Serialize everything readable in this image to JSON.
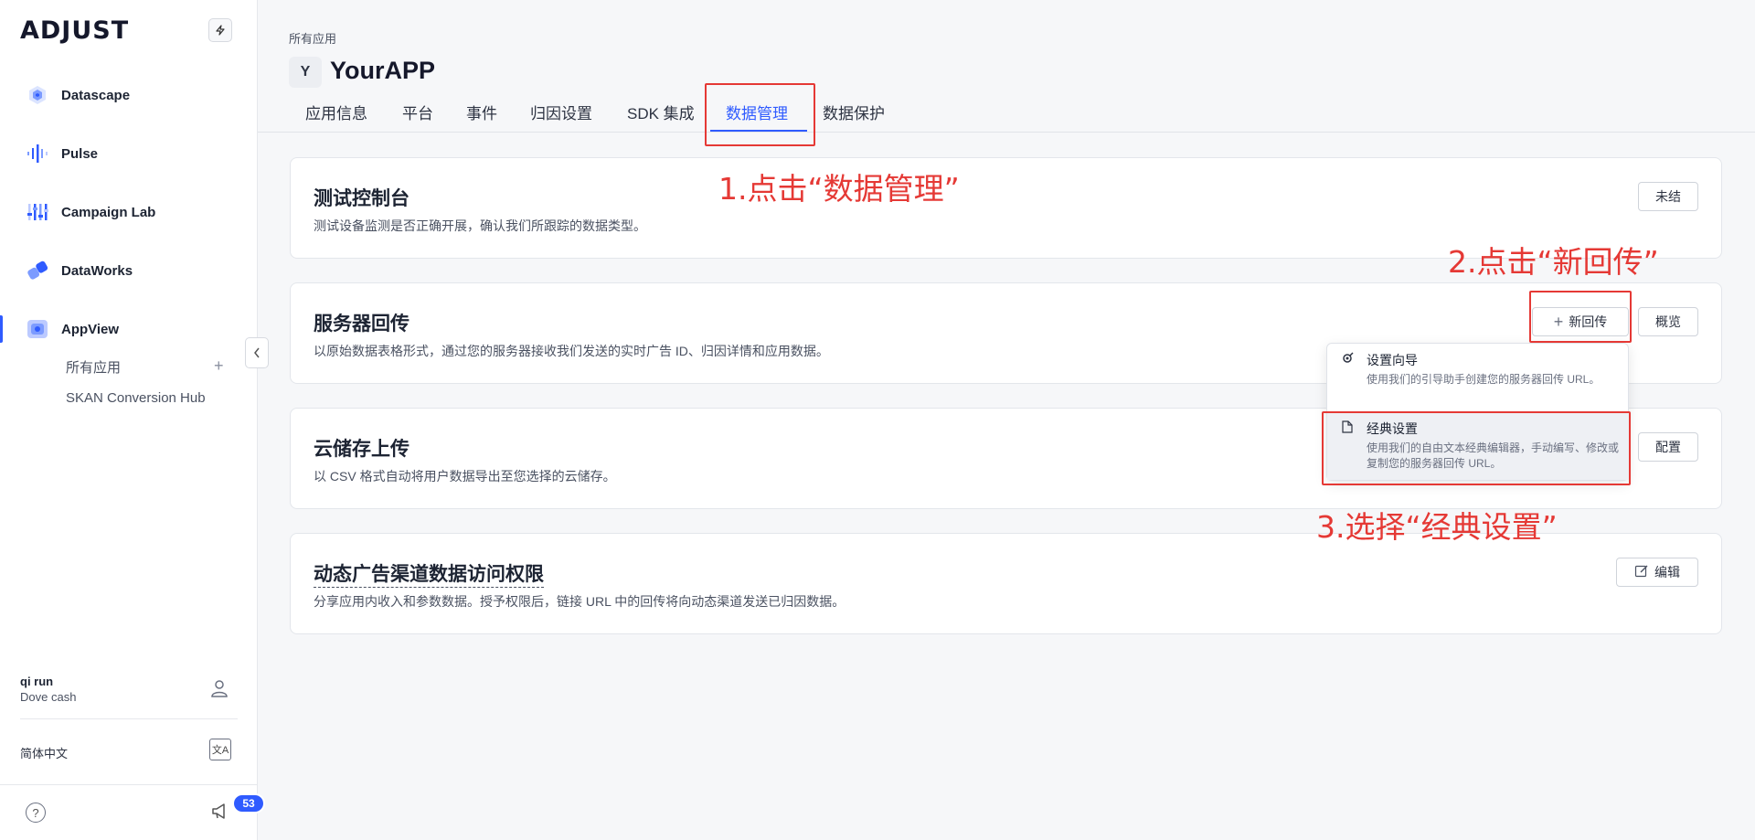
{
  "sidebar": {
    "logo": "ADJUST",
    "nav": [
      {
        "label": "Datascape",
        "icon": "datascape-icon"
      },
      {
        "label": "Pulse",
        "icon": "pulse-icon"
      },
      {
        "label": "Campaign Lab",
        "icon": "campaign-lab-icon"
      },
      {
        "label": "DataWorks",
        "icon": "dataworks-icon"
      },
      {
        "label": "AppView",
        "icon": "appview-icon"
      }
    ],
    "sub_items": [
      "所有应用",
      "SKAN Conversion Hub"
    ],
    "user": {
      "name": "qi run",
      "company": "Dove cash"
    },
    "language": "简体中文",
    "notification_count": "53"
  },
  "header": {
    "breadcrumb": "所有应用",
    "app_avatar": "Y",
    "app_title": "YourAPP",
    "tabs": [
      "应用信息",
      "平台",
      "事件",
      "归因设置",
      "SDK 集成",
      "数据管理",
      "数据保护"
    ],
    "active_tab": "数据管理"
  },
  "cards": [
    {
      "title": "测试控制台",
      "desc": "测试设备监测是否正确开展，确认我们所跟踪的数据类型。",
      "button": "未结"
    },
    {
      "title": "服务器回传",
      "desc": "以原始数据表格形式，通过您的服务器接收我们发送的实时广告 ID、归因详情和应用数据。",
      "button_new": "新回传",
      "button": "概览"
    },
    {
      "title": "云储存上传",
      "desc": "以 CSV 格式自动将用户数据导出至您选择的云储存。",
      "button": "配置"
    },
    {
      "title": "动态广告渠道数据访问权限",
      "desc": "分享应用内收入和参数数据。授予权限后，链接 URL 中的回传将向动态渠道发送已归因数据。",
      "button": "编辑"
    }
  ],
  "dropdown": {
    "items": [
      {
        "title": "设置向导",
        "desc": "使用我们的引导助手创建您的服务器回传 URL。",
        "icon": "wand-icon"
      },
      {
        "title": "经典设置",
        "desc": "使用我们的自由文本经典编辑器，手动编写、修改或复制您的服务器回传 URL。",
        "icon": "document-icon"
      }
    ]
  },
  "annotations": {
    "step1": "1.点击“数据管理”",
    "step2": "2.点击“新回传”",
    "step3": "3.选择“经典设置”"
  },
  "colors": {
    "accent": "#2f5bff",
    "annotation": "#e53935"
  }
}
